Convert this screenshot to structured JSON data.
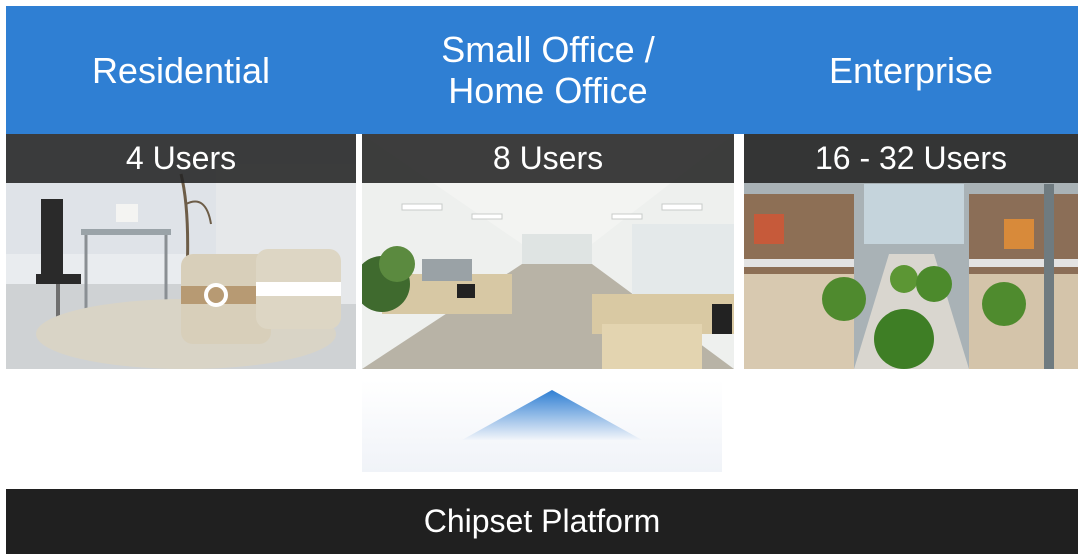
{
  "segments": [
    {
      "title": "Residential",
      "users": "4 Users"
    },
    {
      "title": "Small Office /\nHome Office",
      "users": "8 Users"
    },
    {
      "title": "Enterprise",
      "users": "16 - 32 Users"
    }
  ],
  "platform": {
    "label": "Chipset Platform"
  },
  "colors": {
    "header_blue": "#2f7fd3",
    "bar_dark": "#202020",
    "arrow_blue": "#2f7fd3"
  }
}
